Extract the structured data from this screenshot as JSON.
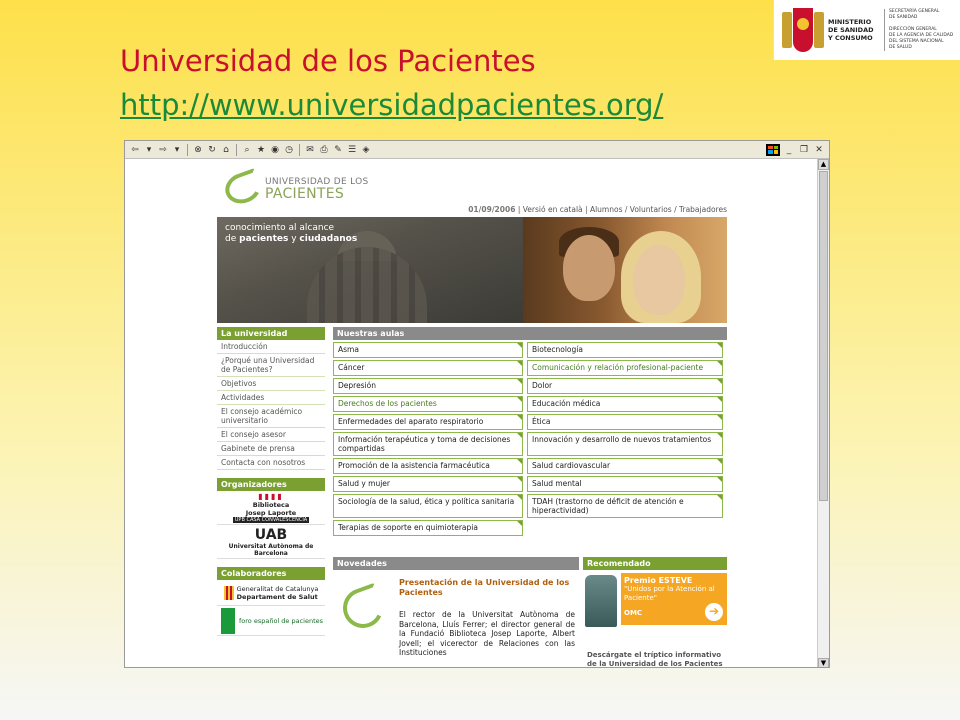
{
  "slide": {
    "title": "Universidad de los Pacientes",
    "url": "http://www.universidadpacientes.org/"
  },
  "ministry": {
    "name_lines": [
      "MINISTERIO",
      "DE SANIDAD",
      "Y CONSUMO"
    ],
    "secretaria": [
      "SECRETARÍA GENERAL",
      "DE SANIDAD"
    ],
    "direccion": [
      "DIRECCIÓN GENERAL",
      "DE LA AGENCIA DE CALIDAD",
      "DEL SISTEMA NACIONAL",
      "DE SALUD"
    ]
  },
  "site": {
    "logo_line1": "UNIVERSIDAD DE LOS",
    "logo_line2": "PACIENTES",
    "topbar": {
      "date": "01/09/2006",
      "lang": "Versió en català",
      "links": "Alumnos / Voluntarios / Trabajadores"
    },
    "hero_tag": {
      "line1": "conocimiento al alcance",
      "line2_pre": "de ",
      "line2_b1": "pacientes",
      "line2_mid": " y ",
      "line2_b2": "ciudadanos"
    },
    "sidebar": {
      "universidad_header": "La universidad",
      "universidad_items": [
        "Introducción",
        "¿Porqué una Universidad de Pacientes?",
        "Objetivos",
        "Actividades",
        "El consejo académico universitario",
        "El consejo asesor",
        "Gabinete de prensa",
        "Contacta con nosotros"
      ],
      "organizadores_header": "Organizadores",
      "org1_line1": "Biblioteca",
      "org1_line2": "Josep Laporte",
      "org1_line3": "UPB CASA CONVALESCÈNCIA",
      "org2_line1": "UAB",
      "org2_line2": "Universitat Autònoma de Barcelona",
      "colaboradores_header": "Colaboradores",
      "col1_line1": "Generalitat de Catalunya",
      "col1_line2": "Departament de Salut",
      "col2": "foro español de pacientes"
    },
    "aulas": {
      "header": "Nuestras aulas",
      "left": [
        "Asma",
        "Cáncer",
        "Depresión",
        "Derechos de los pacientes",
        "Enfermedades del aparato respiratorio",
        "Información terapéutica y toma de decisiones compartidas",
        "Promoción de la asistencia farmacéutica",
        "Salud y mujer",
        "Sociología de la salud, ética y política sanitaria",
        "Terapias de soporte en quimioterapia"
      ],
      "right": [
        "Biotecnología",
        "Comunicación y relación profesional-paciente",
        "Dolor",
        "Educación médica",
        "Ética",
        "Innovación y desarrollo de nuevos tratamientos",
        "Salud cardiovascular",
        "Salud mental",
        "TDAH (trastorno de déficit de atención e hiperactividad)"
      ]
    },
    "novedades": {
      "header": "Novedades",
      "title": "Presentación de la Universidad de los Pacientes",
      "text": "El rector de la Universitat Autònoma de Barcelona, Lluís Ferrer; el director general de la Fundació Biblioteca Josep Laporte, Albert Jovell; el vicerector de Relaciones con las Instituciones"
    },
    "recomendado": {
      "header": "Recomendado",
      "premio": "Premio ESTEVE",
      "slogan": "\"Unidos por la Atención al Paciente\"",
      "omc": "OMC",
      "link": "Descárgate el tríptico informativo de la Universidad de los Pacientes"
    }
  },
  "colors": {
    "title_red": "#c8102e",
    "url_green": "#1a8a3a",
    "site_green": "#7aa032",
    "site_grey": "#8a8a8a"
  }
}
